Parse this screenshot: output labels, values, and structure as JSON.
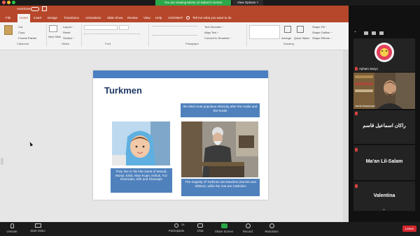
{
  "zoom": {
    "share_banner": "You are viewing Ma'an Lil-Salam's screen",
    "view_options": "View Options ˅",
    "toolbar": {
      "unmute": "Unmute",
      "start_video": "Start Video",
      "participants": "Participants",
      "participants_count": "28",
      "chat": "Chat",
      "share_screen": "Share Screen",
      "record": "Record",
      "reactions": "Reactions",
      "leave": "Leave"
    }
  },
  "ppt": {
    "autosave": "AutoSave",
    "tabs": [
      "File",
      "Home",
      "Insert",
      "Design",
      "Transitions",
      "Animations",
      "Slide Show",
      "Review",
      "View",
      "Help",
      "ACROBAT"
    ],
    "tell_me": "Tell me what you want to do",
    "ribbon": {
      "cut": "Cut",
      "copy": "Copy",
      "format_painter": "Format Painter",
      "new_slide": "New Slide",
      "layout": "Layout ~",
      "reset": "Reset",
      "section": "Section ~",
      "text_direction": "Text Direction ~",
      "align_text": "Align Text ~",
      "convert_smartart": "Convert to SmartArt ~",
      "shape_fill": "Shape Fill ~",
      "shape_outline": "Shape Outline ~",
      "shape_effects": "Shape Effects ~",
      "arrange": "Arrange",
      "quick_styles": "Quick Styles",
      "groups": [
        "Clipboard",
        "Slides",
        "Font",
        "Paragraph",
        "Drawing"
      ]
    },
    "slide": {
      "title": "Turkmen",
      "caption_top": "the third most populous ethnicity after the Arabs and the Kurds",
      "caption_left": "They live in Tal Afar (west of Mosul), Mosul, Erbil, Altun Kupri, Kirkuk, Tuz Khurmatu, Kifri and Khanaqin",
      "caption_right": "The majority of Turkmen are Muslims (Sunnis and Shiites), while the rest are Catholics"
    }
  },
  "participants": {
    "self_name": "Ayham Saryo",
    "speaker_name": "Jamil Alnashawi",
    "tiles": [
      {
        "name": "راكان اسماعيل قاسم"
      },
      {
        "name": "Ma'an Lil-Salam"
      },
      {
        "name": "Valentina"
      }
    ]
  }
}
